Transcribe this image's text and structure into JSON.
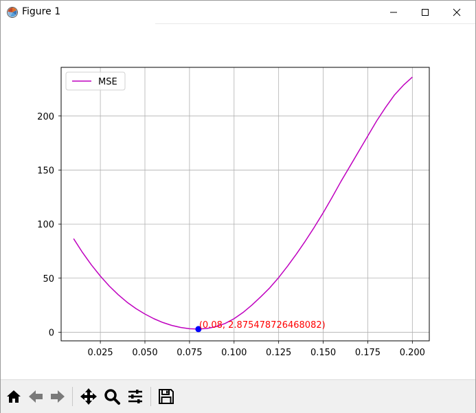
{
  "window": {
    "title": "Figure 1",
    "icon": "matplotlib-figure-icon",
    "controls": [
      "minimize-icon",
      "maximize-icon",
      "close-icon"
    ]
  },
  "toolbar": {
    "buttons": [
      "home-icon",
      "back-arrow-icon",
      "forward-arrow-icon",
      "pan-move-icon",
      "zoom-magnifier-icon",
      "subplots-config-icon",
      "save-disk-icon"
    ]
  },
  "chart_data": {
    "type": "line",
    "title": "",
    "xlabel": "",
    "ylabel": "",
    "xlim": [
      0.003,
      0.2095
    ],
    "ylim": [
      -8,
      245
    ],
    "xticks": [
      "0.025",
      "0.050",
      "0.075",
      "0.100",
      "0.125",
      "0.150",
      "0.175",
      "0.200"
    ],
    "xtick_values": [
      0.025,
      0.05,
      0.075,
      0.1,
      0.125,
      0.15,
      0.175,
      0.2
    ],
    "yticks": [
      "0",
      "50",
      "100",
      "150",
      "200"
    ],
    "ytick_values": [
      0,
      50,
      100,
      150,
      200
    ],
    "grid": true,
    "legend_position": "upper-left",
    "series": [
      {
        "name": "MSE",
        "color": "#bf00bf",
        "x": [
          0.01,
          0.015,
          0.02,
          0.025,
          0.03,
          0.035,
          0.04,
          0.045,
          0.05,
          0.055,
          0.06,
          0.065,
          0.07,
          0.075,
          0.08,
          0.085,
          0.09,
          0.095,
          0.1,
          0.105,
          0.11,
          0.115,
          0.12,
          0.125,
          0.13,
          0.135,
          0.14,
          0.145,
          0.15,
          0.155,
          0.16,
          0.165,
          0.17,
          0.175,
          0.18,
          0.185,
          0.19,
          0.195,
          0.2
        ],
        "y": [
          86.5,
          73.7,
          62.2,
          51.9,
          42.7,
          34.7,
          27.7,
          21.8,
          16.8,
          12.5,
          9.0,
          6.3,
          4.4,
          3.2,
          2.9,
          3.5,
          5.2,
          8.1,
          12.5,
          18.2,
          25.1,
          32.8,
          41.0,
          50.5,
          61.1,
          72.4,
          84.4,
          97.1,
          110.5,
          124.8,
          139.6,
          153.5,
          167.5,
          181.5,
          195.5,
          208.0,
          219.5,
          228.5,
          236.0
        ]
      }
    ],
    "highlight_point": {
      "x": 0.08,
      "y": 2.875478726468082,
      "color": "#0000ff"
    },
    "annotation": {
      "text": "(0.08, 2.875478726468082)",
      "x": 0.08,
      "y": 2.875478726468082,
      "color": "#ff0000"
    }
  }
}
